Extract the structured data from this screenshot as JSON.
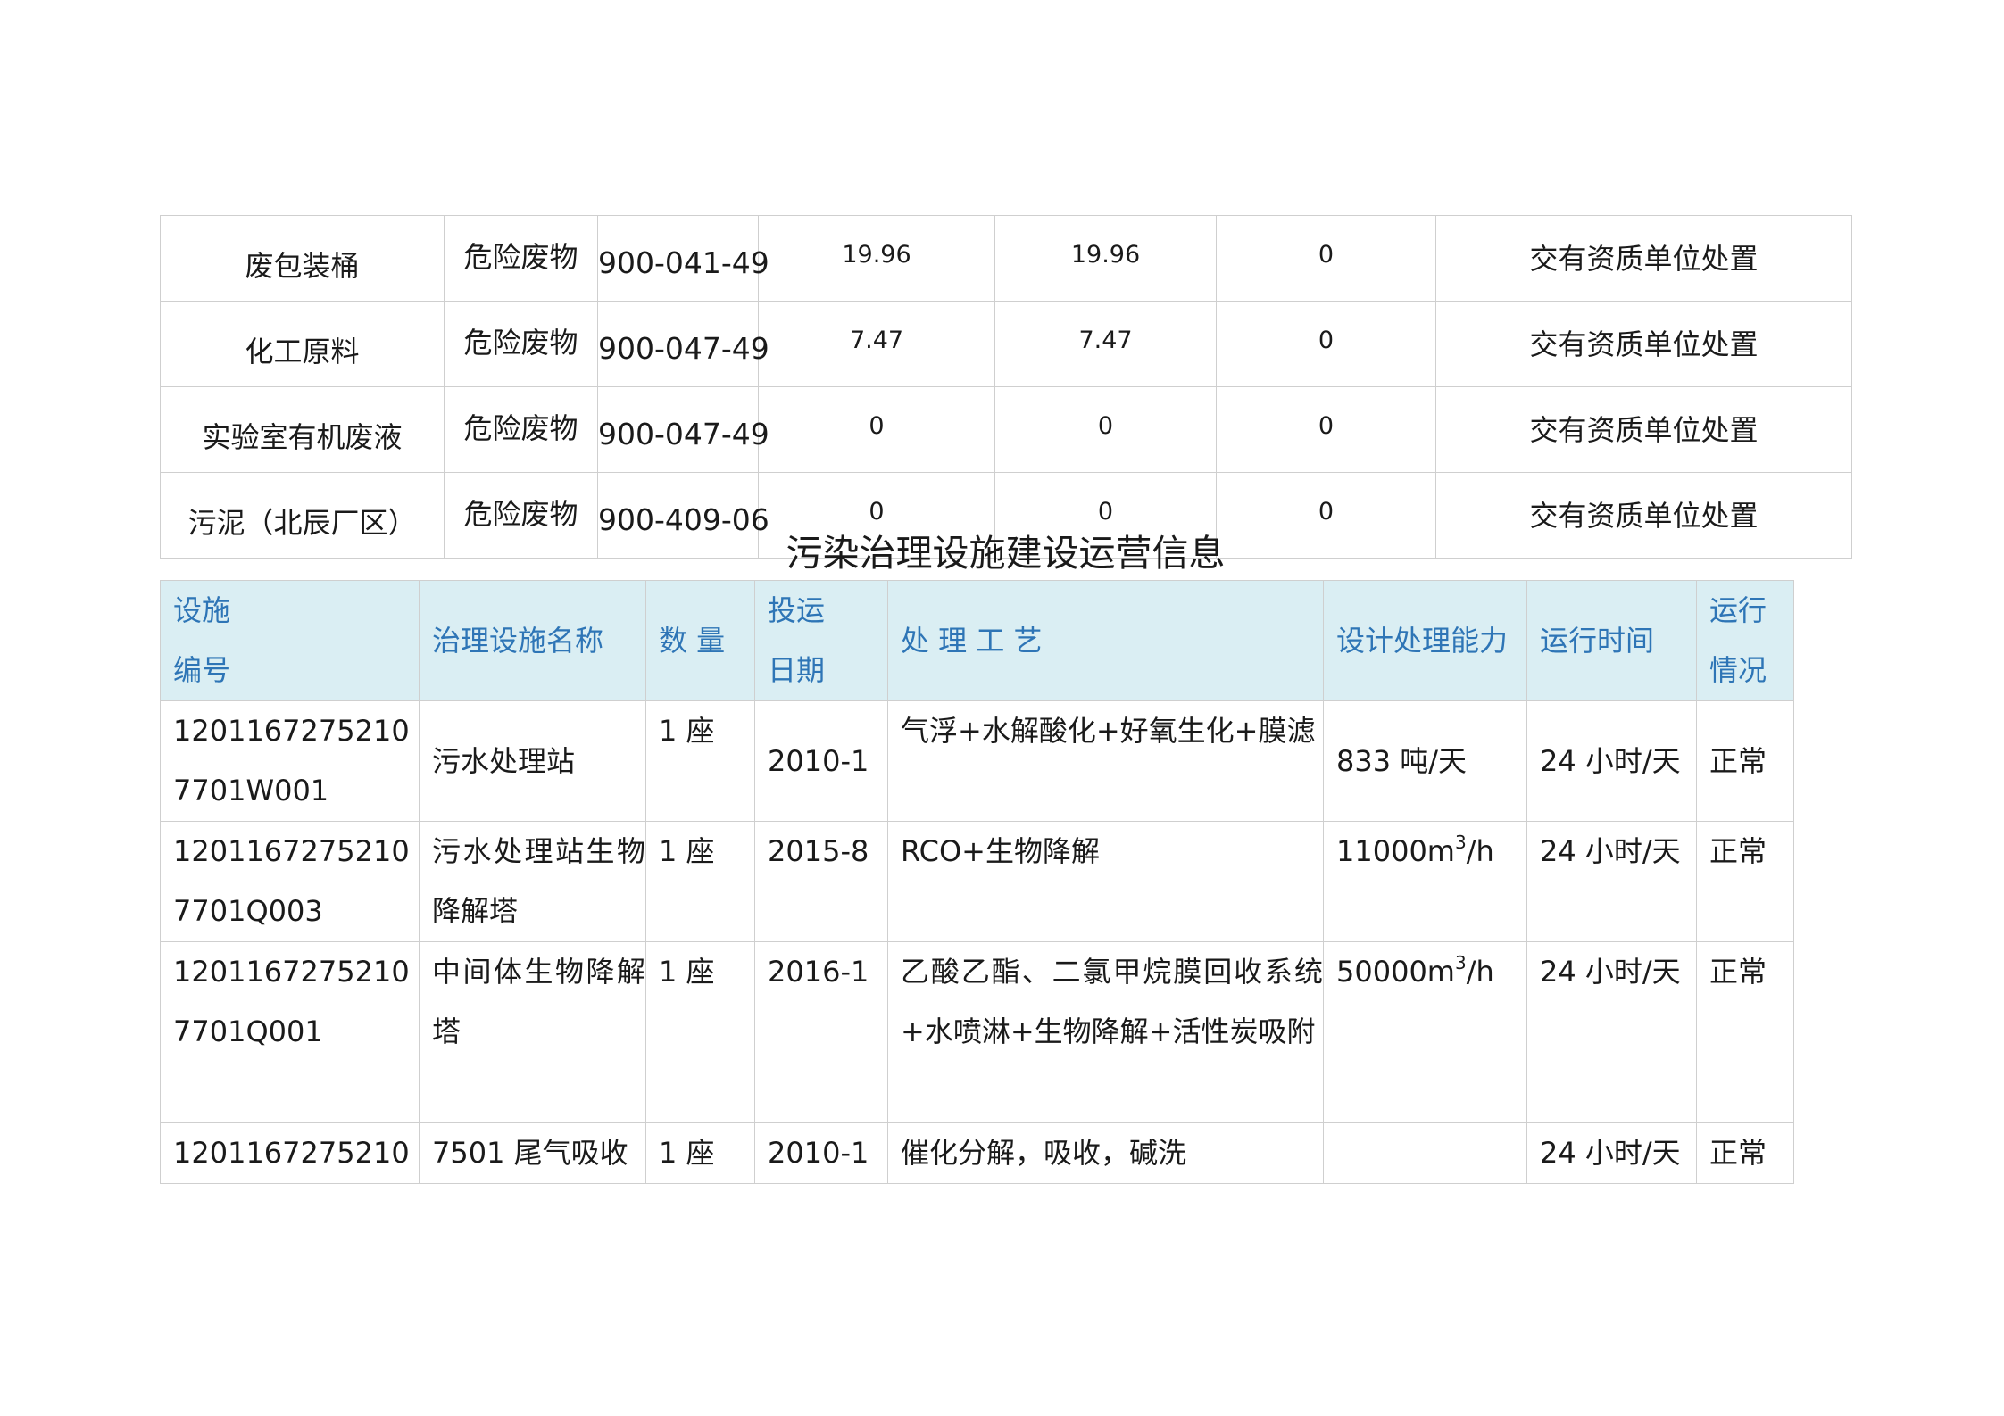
{
  "waste_rows": [
    {
      "name": "废包装桶",
      "category": "危险废物",
      "code": "900-041-49",
      "generated": "19.96",
      "disposed": "19.96",
      "stored": "0",
      "disposal": "交有资质单位处置"
    },
    {
      "name": "化工原料",
      "category": "危险废物",
      "code": "900-047-49",
      "generated": "7.47",
      "disposed": "7.47",
      "stored": "0",
      "disposal": "交有资质单位处置"
    },
    {
      "name": "实验室有机废液",
      "category": "危险废物",
      "code": "900-047-49",
      "generated": "0",
      "disposed": "0",
      "stored": "0",
      "disposal": "交有资质单位处置"
    },
    {
      "name": "污泥（北辰厂区）",
      "category": "危险废物",
      "code": "900-409-06",
      "generated": "0",
      "disposed": "0",
      "stored": "0",
      "disposal": "交有资质单位处置"
    }
  ],
  "section_title": "污染治理设施建设运营信息",
  "facility_headers": {
    "id_line1": "设施",
    "id_line2": "编号",
    "name": "治理设施名称",
    "quantity": "数 量",
    "date_line1": "投运",
    "date_line2": "日期",
    "process": "处 理 工 艺",
    "capacity": "设计处理能力",
    "runtime": "运行时间",
    "status_line1": "运行",
    "status_line2": "情况"
  },
  "facility_rows": [
    {
      "id_line1": "1201167275210",
      "id_line2": "7701W001",
      "name": "污水处理站",
      "quantity": "1 座",
      "date": "2010-1",
      "process": "气浮+水解酸化+好氧生化+膜滤",
      "capacity_value": "833 吨/天",
      "capacity_sup": "",
      "capacity_unit": "",
      "runtime": "24 小时/天",
      "status": "正常"
    },
    {
      "id_line1": "1201167275210",
      "id_line2": "7701Q003",
      "name": "污水处理站生物降解塔",
      "quantity": "1 座",
      "date": "2015-8",
      "process": "RCO+生物降解",
      "capacity_value": "11000m",
      "capacity_sup": "3",
      "capacity_unit": "/h",
      "runtime": "24 小时/天",
      "status": "正常"
    },
    {
      "id_line1": "1201167275210",
      "id_line2": "7701Q001",
      "name": "中间体生物降解塔",
      "quantity": "1 座",
      "date": "2016-1",
      "process": "乙酸乙酯、二氯甲烷膜回收系统+水喷淋+生物降解+活性炭吸附",
      "capacity_value": "50000m",
      "capacity_sup": "3",
      "capacity_unit": "/h",
      "runtime": "24 小时/天",
      "status": "正常"
    },
    {
      "id_line1": "1201167275210",
      "id_line2": "",
      "name": "7501 尾气吸收",
      "quantity": "1 座",
      "date": "2010-1",
      "process": "催化分解，吸收，碱洗",
      "capacity_value": "",
      "capacity_sup": "",
      "capacity_unit": "",
      "runtime": "24 小时/天",
      "status": "正常"
    }
  ]
}
